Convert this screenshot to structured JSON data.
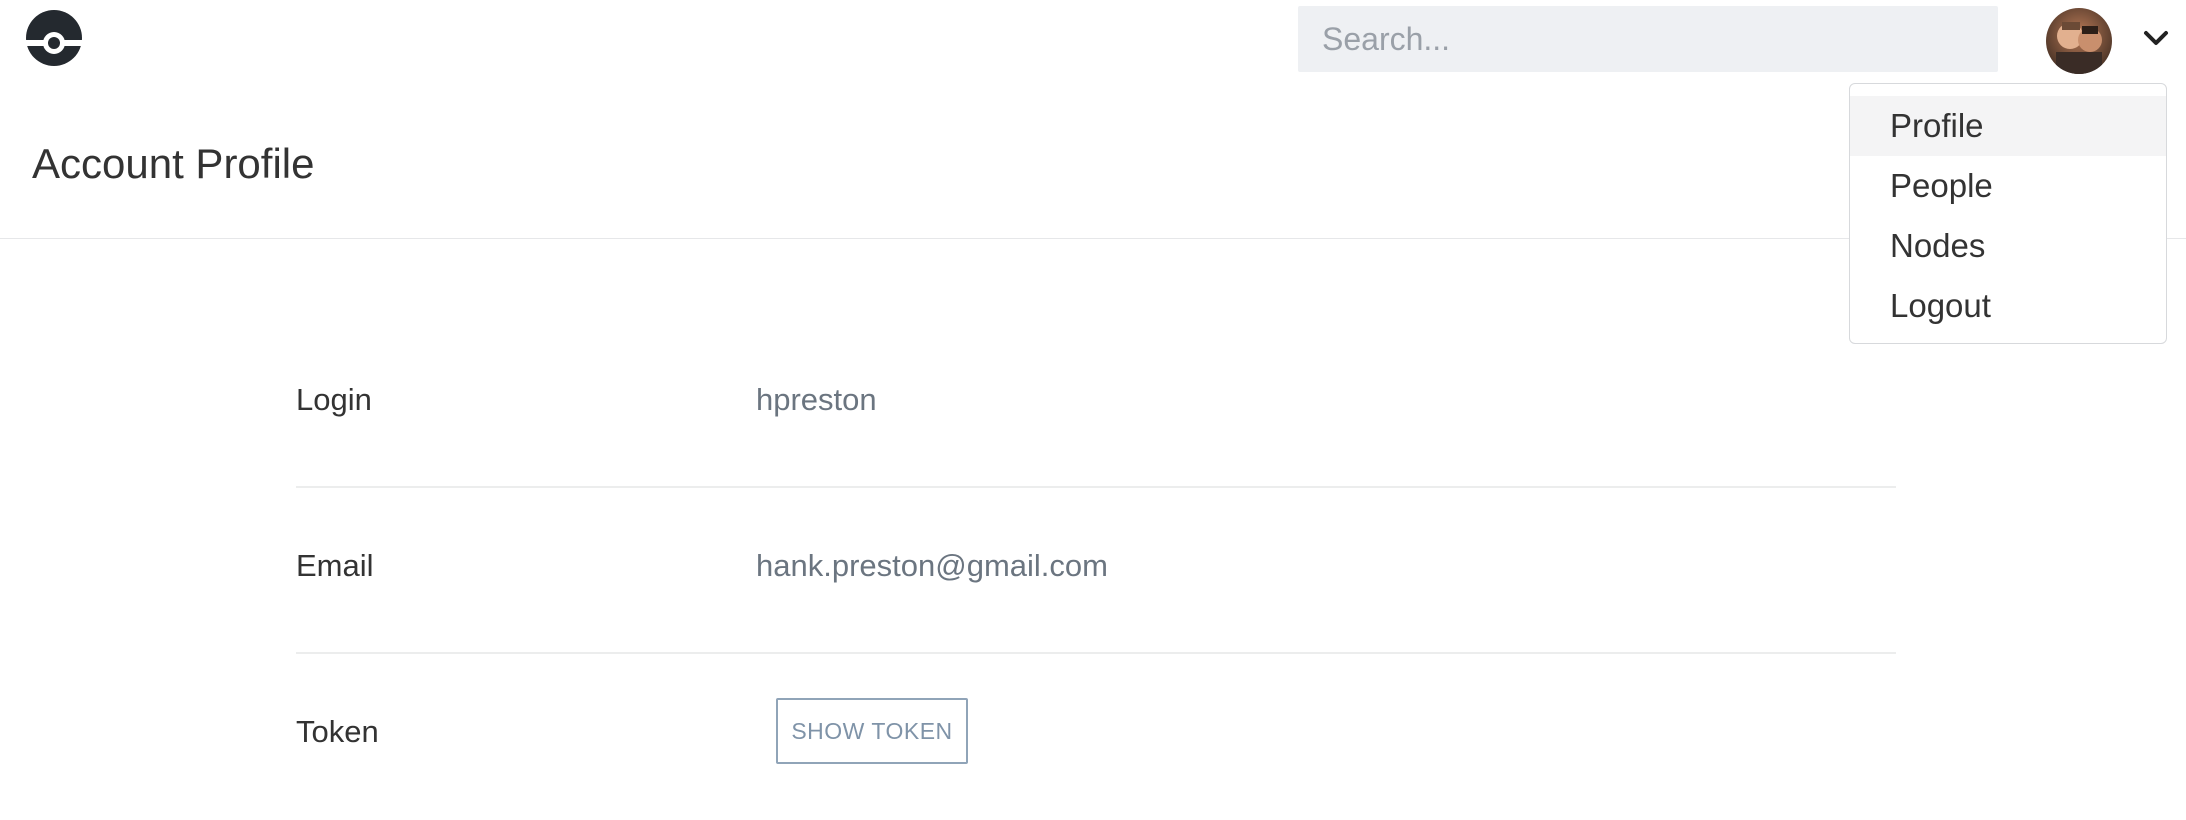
{
  "header": {
    "logo_icon": "drone-logo-icon",
    "search": {
      "placeholder": "Search...",
      "value": ""
    },
    "avatar_alt": "user avatar",
    "menu_icon": "chevron-down-icon"
  },
  "page": {
    "title": "Account Profile"
  },
  "dropdown": {
    "items": [
      {
        "label": "Profile",
        "active": true
      },
      {
        "label": "People",
        "active": false
      },
      {
        "label": "Nodes",
        "active": false
      },
      {
        "label": "Logout",
        "active": false
      }
    ]
  },
  "profile": {
    "rows": [
      {
        "label": "Login",
        "value": "hpreston"
      },
      {
        "label": "Email",
        "value": "hank.preston@gmail.com"
      },
      {
        "label": "Token",
        "button_label": "SHOW TOKEN"
      }
    ]
  },
  "colors": {
    "accent_button_border": "#90a4b8",
    "search_background": "#eef0f3",
    "active_menu_background": "#f4f4f5"
  }
}
